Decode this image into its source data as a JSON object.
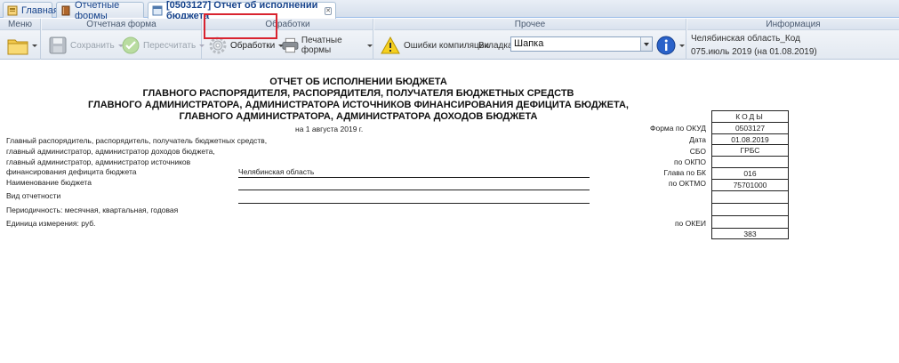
{
  "tabs": [
    {
      "label": "Главная"
    },
    {
      "label": "Отчетные формы"
    },
    {
      "label": "[0503127] Отчет об исполнении бюджета"
    }
  ],
  "ribbon": {
    "menu": {
      "header": "Меню"
    },
    "report_form": {
      "header": "Отчетная форма",
      "save_label": "Сохранить",
      "recalc_label": "Пересчитать"
    },
    "processing": {
      "header": "Обработки",
      "processing_label": "Обработки",
      "print_label": "Печатные формы"
    },
    "other": {
      "header": "Прочее",
      "errors_label": "Ошибки компиляции",
      "tab_label": "Вкладка",
      "tab_value": "Шапка"
    },
    "info": {
      "header": "Информация",
      "region": "Челябинская область_Код",
      "period": "075.июль 2019 (на 01.08.2019)"
    }
  },
  "document": {
    "title_lines": [
      "ОТЧЕТ ОБ ИСПОЛНЕНИИ БЮДЖЕТА",
      "ГЛАВНОГО РАСПОРЯДИТЕЛЯ, РАСПОРЯДИТЕЛЯ, ПОЛУЧАТЕЛЯ БЮДЖЕТНЫХ СРЕДСТВ",
      "ГЛАВНОГО АДМИНИСТРАТОРА, АДМИНИСТРАТОРА ИСТОЧНИКОВ ФИНАНСИРОВАНИЯ ДЕФИЦИТА БЮДЖЕТА,",
      "ГЛАВНОГО АДМИНИСТРАТОРА, АДМИНИСТРАТОРА ДОХОДОВ БЮДЖЕТА"
    ],
    "date_line": "на 1 августа 2019 г.",
    "left_labels": [
      "Главный распорядитель, распорядитель, получатель бюджетных средств,",
      "главный администратор, администратор доходов бюджета,",
      "главный администратор, администратор источников",
      "финансирования дефицита бюджета",
      "Наименование бюджета",
      "Вид отчетности",
      "Периодичность: месячная, квартальная, годовая",
      "Единица измерения: руб."
    ],
    "organization": "Челябинская область",
    "codes_header": "КОДЫ",
    "codes": [
      {
        "label": "Форма по ОКУД",
        "value": "0503127"
      },
      {
        "label": "Дата",
        "value": "01.08.2019"
      },
      {
        "label": "СБО",
        "value": "ГРБС"
      },
      {
        "label": "по ОКПО",
        "value": ""
      },
      {
        "label": "Глава по БК",
        "value": "016"
      },
      {
        "label": "по ОКТМО",
        "value": "75701000"
      },
      {
        "label": "",
        "value": ""
      },
      {
        "label": "",
        "value": ""
      },
      {
        "label": "",
        "value": ""
      },
      {
        "label": "по ОКЕИ",
        "value": "383"
      }
    ]
  }
}
